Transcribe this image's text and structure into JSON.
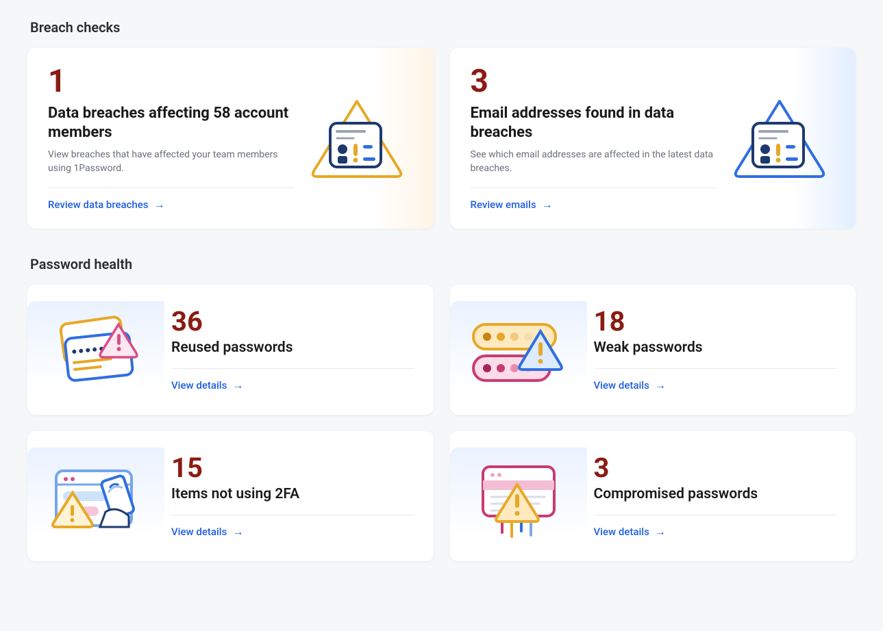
{
  "sections": {
    "breach": {
      "title": "Breach checks"
    },
    "password": {
      "title": "Password health"
    }
  },
  "breach_cards": [
    {
      "count": "1",
      "title": "Data breaches affecting 58 account members",
      "desc": "View breaches that have affected your team members using 1Password.",
      "action": "Review data breaches",
      "tint": "orange"
    },
    {
      "count": "3",
      "title": "Email addresses found in data breaches",
      "desc": "See which email addresses are affected in the latest data breaches.",
      "action": "Review emails",
      "tint": "blue"
    }
  ],
  "password_cards": [
    {
      "count": "36",
      "title": "Reused passwords",
      "action": "View details"
    },
    {
      "count": "18",
      "title": "Weak passwords",
      "action": "View details"
    },
    {
      "count": "15",
      "title": "Items not using 2FA",
      "action": "View details"
    },
    {
      "count": "3",
      "title": "Compromised passwords",
      "action": "View details"
    }
  ],
  "colors": {
    "count": "#8a1c13",
    "link": "#1f5fe0"
  }
}
